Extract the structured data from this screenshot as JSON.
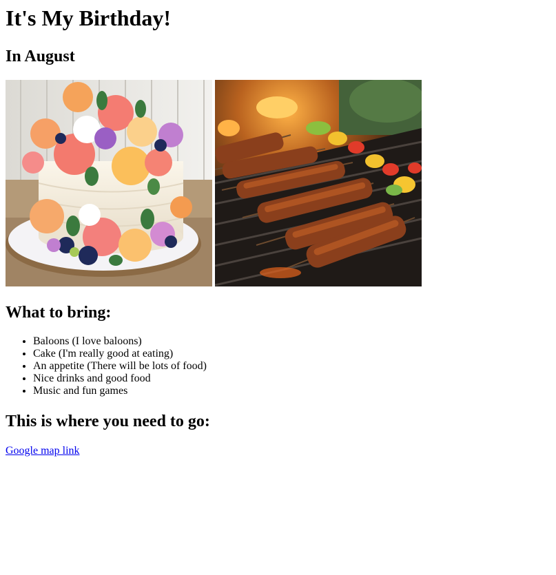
{
  "page": {
    "title": "It's My Birthday!",
    "subtitle": "In August"
  },
  "images": [
    {
      "name": "cake-image",
      "alt": "birthday cake"
    },
    {
      "name": "barbecue-image",
      "alt": "barbecue skewers"
    }
  ],
  "bring": {
    "heading": "What to bring:",
    "items": [
      "Baloons (I love baloons)",
      "Cake (I'm really good at eating)",
      "An appetite (There will be lots of food)",
      "Nice drinks and good food",
      "Music and fun games"
    ]
  },
  "directions": {
    "heading": "This is where you need to go:",
    "link_text": "Google map link"
  },
  "colors": {
    "link": "#0000ee",
    "text": "#000000"
  }
}
